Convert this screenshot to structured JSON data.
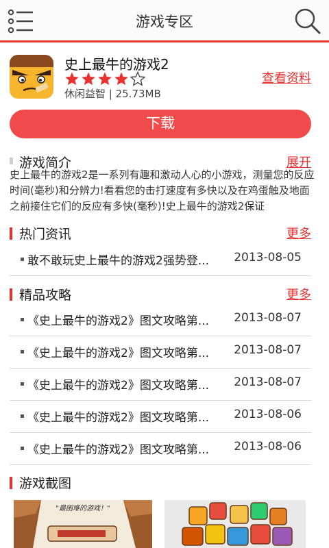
{
  "header": {
    "title": "游戏专区",
    "menu_icon": "menu-list-icon",
    "search_icon": "search-icon"
  },
  "app": {
    "name": "史上最牛的游戏2",
    "rating": 4,
    "rating_max": 5,
    "category": "休闲益智",
    "size": "25.73MB",
    "meta": "休闲益智 | 25.73MB",
    "detail_link": "查看资料",
    "download_label": "下载"
  },
  "intro": {
    "title": "游戏简介",
    "expand": "展开",
    "text": "史上最牛的游戏2是一系列有趣和激动人心的小游戏，测量您的反应时间(毫秒)和分辨力!看看您的击打速度有多快以及在鸡蛋触及地面之前接住它们的反应有多快(毫秒)!史上最牛的游戏2保证"
  },
  "news": {
    "title": "热门资讯",
    "more": "更多",
    "items": [
      {
        "title": "敢不敢玩史上最牛的游戏2强势登...",
        "date": "2013-08-05"
      }
    ]
  },
  "guides": {
    "title": "精品攻略",
    "more": "更多",
    "items": [
      {
        "title": "《史上最牛的游戏2》图文攻略第...",
        "date": "2013-08-07"
      },
      {
        "title": "《史上最牛的游戏2》图文攻略第...",
        "date": "2013-08-07"
      },
      {
        "title": "《史上最牛的游戏2》图文攻略第...",
        "date": "2013-08-07"
      },
      {
        "title": "《史上最牛的游戏2》图文攻略第...",
        "date": "2013-08-06"
      },
      {
        "title": "《史上最牛的游戏2》图文攻略第...",
        "date": "2013-08-06"
      }
    ]
  },
  "screenshots": {
    "title": "游戏截图",
    "shot1_caption": "\"最困难的游戏！\""
  },
  "colors": {
    "accent": "#e8322f",
    "button": "#f14a4a",
    "star": "#e8322f"
  }
}
